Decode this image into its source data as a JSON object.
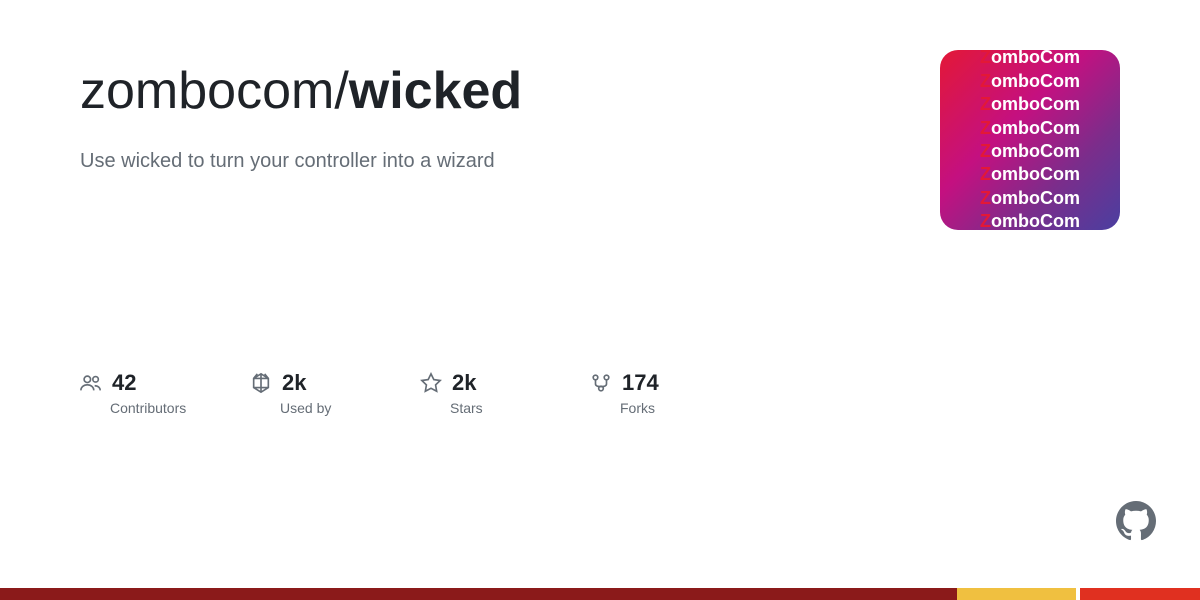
{
  "repo": {
    "owner": "zombocom",
    "name": "wicked",
    "description": "Use wicked to turn your controller into a wizard"
  },
  "logo": {
    "lines": [
      "ZomboCom",
      "ZomboCom",
      "ZomboCom",
      "ZomboCom",
      "ZomboCom",
      "ZomboCom",
      "ZomboCom",
      "ZomboCom"
    ]
  },
  "stats": [
    {
      "icon": "contributors-icon",
      "value": "42",
      "label": "Contributors"
    },
    {
      "icon": "used-by-icon",
      "value": "2k",
      "label": "Used by"
    },
    {
      "icon": "stars-icon",
      "value": "2k",
      "label": "Stars"
    },
    {
      "icon": "forks-icon",
      "value": "174",
      "label": "Forks"
    }
  ],
  "bottom_bar": {
    "segments": [
      "dark-red",
      "yellow",
      "orange-red"
    ]
  }
}
